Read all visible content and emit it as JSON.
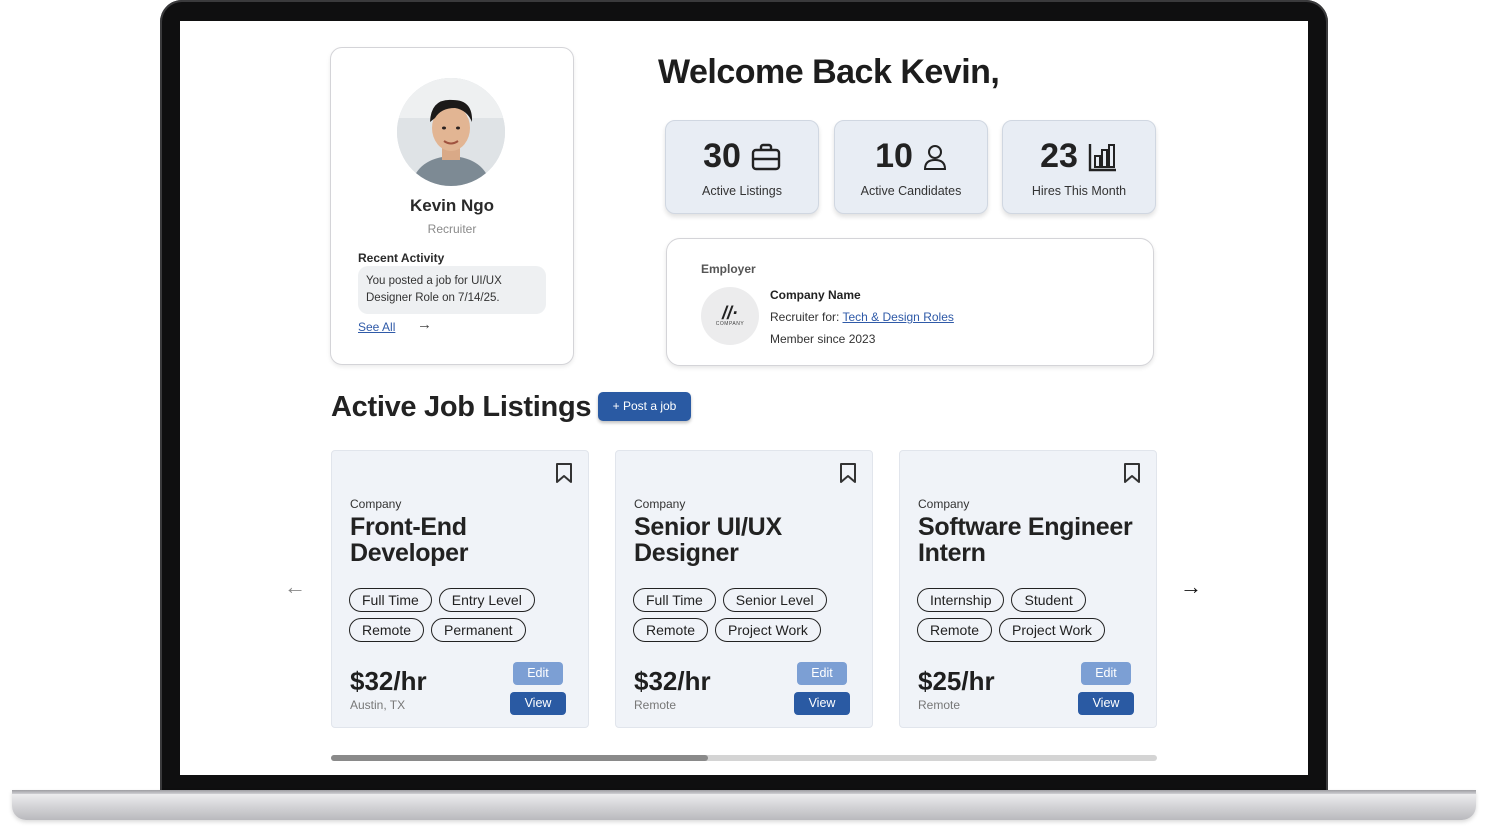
{
  "profile": {
    "name": "Kevin Ngo",
    "role": "Recruiter",
    "recent_activity_title": "Recent Activity",
    "recent_activity_text": "You posted a job for UI/UX Designer Role on 7/14/25.",
    "see_all": "See All"
  },
  "welcome": "Welcome Back Kevin,",
  "stats": [
    {
      "value": "30",
      "label": "Active Listings",
      "icon": "briefcase-icon"
    },
    {
      "value": "10",
      "label": "Active Candidates",
      "icon": "person-icon"
    },
    {
      "value": "23",
      "label": "Hires This Month",
      "icon": "bar-chart-icon"
    }
  ],
  "employer": {
    "title": "Employer",
    "logo_text": "COMPANY",
    "company_name": "Company Name",
    "recruiter_for_label": "Recruiter for:",
    "recruiter_for_link": "Tech & Design Roles",
    "member_since": "Member since 2023"
  },
  "listings": {
    "title": "Active Job Listings",
    "post_button": "+ Post a job",
    "scroll_position": 0.46,
    "jobs": [
      {
        "company": "Company",
        "title": "Front-End Developer",
        "tags": [
          "Full Time",
          "Entry Level",
          "Remote",
          "Permanent"
        ],
        "price": "$32/hr",
        "location": "Austin, TX",
        "edit": "Edit",
        "view": "View"
      },
      {
        "company": "Company",
        "title": "Senior UI/UX Designer",
        "tags": [
          "Full Time",
          "Senior Level",
          "Remote",
          "Project Work"
        ],
        "price": "$32/hr",
        "location": "Remote",
        "edit": "Edit",
        "view": "View"
      },
      {
        "company": "Company",
        "title": "Software Engineer Intern",
        "tags": [
          "Internship",
          "Student",
          "Remote",
          "Project Work"
        ],
        "price": "$25/hr",
        "location": "Remote",
        "edit": "Edit",
        "view": "View"
      }
    ]
  },
  "colors": {
    "primary": "#2a5aa3",
    "edit_button": "#7c9fd4",
    "stat_card": "#e8edf4",
    "job_card": "#f0f3f8"
  }
}
